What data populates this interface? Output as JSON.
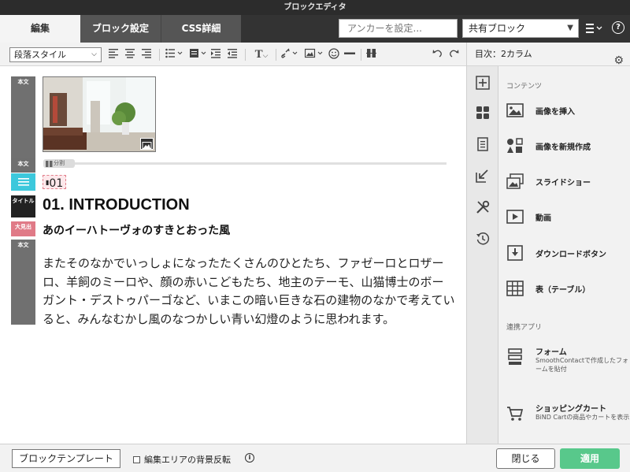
{
  "window": {
    "title": "ブロックエディタ"
  },
  "tabs": {
    "edit": "編集",
    "block_settings": "ブロック設定",
    "css_detail": "CSS詳細"
  },
  "header": {
    "anchor_placeholder": "アンカーを設定...",
    "shared_block": "共有ブロック",
    "menu_icon": "hamburger-menu-icon",
    "help_label": "?"
  },
  "toolbar": {
    "paragraph_style": "段落スタイル",
    "icons": [
      "align-left-icon",
      "align-center-icon",
      "align-right-icon",
      "list-icon",
      "block-format-icon",
      "indent-icon",
      "outdent-icon",
      "text-format-icon",
      "link-icon",
      "image-icon",
      "emoji-icon",
      "horizontal-rule-icon",
      "column-icon",
      "undo-icon",
      "redo-icon"
    ]
  },
  "editor": {
    "gutter_labels": [
      "本文",
      "本文",
      "",
      "タイトル",
      "大見出",
      "本文"
    ],
    "split_label": "分割",
    "number_label": "01",
    "heading": "01. INTRODUCTION",
    "subheading": "あのイーハトーヴォのすきとおった風",
    "body": "またそのなかでいっしょになったたくさんのひとたち、ファゼーロとロザーロ、羊飼のミーロや、顔の赤いこどもたち、地主のテーモ、山猫博士のボーガント・デストゥパーゴなど、いまこの暗い巨きな石の建物のなかで考えていると、みんなむかし風のなつかしい青い幻燈のように思われます。"
  },
  "sidebar": {
    "title": "目次：2カラム",
    "section_contents": "コンテンツ",
    "items": [
      {
        "label": "画像を挿入",
        "icon": "image-insert-icon"
      },
      {
        "label": "画像を新規作成",
        "icon": "image-create-icon"
      },
      {
        "label": "スライドショー",
        "icon": "slideshow-icon"
      },
      {
        "label": "動画",
        "icon": "video-icon"
      },
      {
        "label": "ダウンロードボタン",
        "icon": "download-icon"
      },
      {
        "label": "表（テーブル）",
        "icon": "table-icon"
      }
    ],
    "section_apps": "連携アプリ",
    "apps": [
      {
        "label": "フォーム",
        "desc": "SmoothContactで作成したフォームを貼付",
        "icon": "form-icon"
      },
      {
        "label": "ショッピングカート",
        "desc": "BiND Cartの商品やカートを表示",
        "icon": "cart-icon"
      }
    ],
    "rail_icons": [
      "add-block-icon",
      "grid-icon",
      "page-icon",
      "import-icon",
      "tools-icon",
      "history-icon"
    ]
  },
  "footer": {
    "template_button": "ブロックテンプレート",
    "invert_checkbox": "編集エリアの背景反転",
    "close_button": "閉じる",
    "apply_button": "適用"
  },
  "colors": {
    "accent_green": "#58c88b",
    "accent_cyan": "#3cc8dc",
    "accent_pink": "#e07a87",
    "dark_bar": "#333333"
  }
}
